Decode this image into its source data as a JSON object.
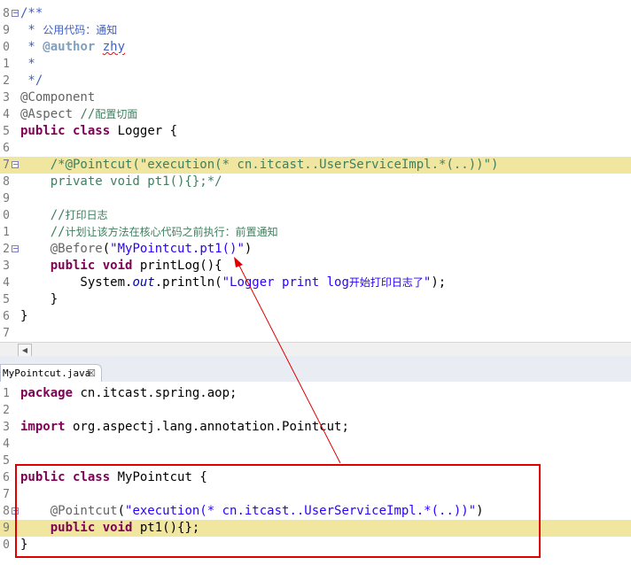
{
  "top_editor": {
    "lines": [
      {
        "num": "8",
        "fold": "−",
        "parts": [
          {
            "c": "jd",
            "t": "/**"
          }
        ]
      },
      {
        "num": "9",
        "parts": [
          {
            "c": "jd",
            "t": " * "
          },
          {
            "c": "jd cn",
            "t": "公用代码：通知"
          }
        ]
      },
      {
        "num": "0",
        "parts": [
          {
            "c": "jd",
            "t": " * "
          },
          {
            "c": "jdtag",
            "t": "@author"
          },
          {
            "c": "jd",
            "t": " "
          },
          {
            "c": "jd squig",
            "t": "zhy"
          }
        ]
      },
      {
        "num": "1",
        "parts": [
          {
            "c": "jd",
            "t": " *"
          }
        ]
      },
      {
        "num": "2",
        "parts": [
          {
            "c": "jd",
            "t": " */"
          }
        ]
      },
      {
        "num": "3",
        "parts": [
          {
            "c": "ann",
            "t": "@Component"
          }
        ]
      },
      {
        "num": "4",
        "parts": [
          {
            "c": "ann",
            "t": "@Aspect"
          },
          {
            "c": "",
            "t": " "
          },
          {
            "c": "cm",
            "t": "//"
          },
          {
            "c": "cm cn",
            "t": "配置切面"
          }
        ]
      },
      {
        "num": "5",
        "parts": [
          {
            "c": "kw",
            "t": "public"
          },
          {
            "c": "",
            "t": " "
          },
          {
            "c": "kw",
            "t": "class"
          },
          {
            "c": "",
            "t": " Logger {"
          }
        ]
      },
      {
        "num": "6",
        "parts": []
      },
      {
        "num": "7",
        "fold": "−",
        "hl": "hl2",
        "parts": [
          {
            "c": "",
            "t": "    "
          },
          {
            "c": "cm",
            "t": "/*@Pointcut(\"execution(* cn.itcast..UserServiceImpl.*(..))\")"
          }
        ]
      },
      {
        "num": "8",
        "parts": [
          {
            "c": "cm",
            "t": "    private void pt1(){};*/"
          }
        ]
      },
      {
        "num": "9",
        "parts": []
      },
      {
        "num": "0",
        "parts": [
          {
            "c": "cm",
            "t": "    //"
          },
          {
            "c": "cm cn",
            "t": "打印日志"
          }
        ]
      },
      {
        "num": "1",
        "parts": [
          {
            "c": "cm",
            "t": "    //"
          },
          {
            "c": "cm cn",
            "t": "计划让该方法在核心代码之前执行：前置通知"
          }
        ]
      },
      {
        "num": "2",
        "fold": "−",
        "parts": [
          {
            "c": "",
            "t": "    "
          },
          {
            "c": "ann",
            "t": "@Before"
          },
          {
            "c": "",
            "t": "("
          },
          {
            "c": "str",
            "t": "\"MyPointcut.pt1()\""
          },
          {
            "c": "",
            "t": ")"
          }
        ]
      },
      {
        "num": "3",
        "parts": [
          {
            "c": "",
            "t": "    "
          },
          {
            "c": "kw",
            "t": "public"
          },
          {
            "c": "",
            "t": " "
          },
          {
            "c": "kw",
            "t": "void"
          },
          {
            "c": "",
            "t": " printLog(){"
          }
        ]
      },
      {
        "num": "4",
        "parts": [
          {
            "c": "",
            "t": "        System."
          },
          {
            "c": "fld",
            "t": "out"
          },
          {
            "c": "",
            "t": ".println("
          },
          {
            "c": "str",
            "t": "\"Logger print log"
          },
          {
            "c": "str cn",
            "t": "开始打印日志了"
          },
          {
            "c": "str",
            "t": "\""
          },
          {
            "c": "",
            "t": ");"
          }
        ]
      },
      {
        "num": "5",
        "parts": [
          {
            "c": "",
            "t": "    }"
          }
        ]
      },
      {
        "num": "6",
        "parts": [
          {
            "c": "",
            "t": "}"
          }
        ]
      },
      {
        "num": "7",
        "parts": []
      }
    ]
  },
  "scroll_left_glyph": "◀",
  "tab": {
    "label": "MyPointcut.java",
    "close": "☒"
  },
  "bottom_editor": {
    "lines": [
      {
        "num": "1",
        "parts": [
          {
            "c": "kw",
            "t": "package"
          },
          {
            "c": "",
            "t": " cn.itcast.spring.aop;"
          }
        ]
      },
      {
        "num": "2",
        "parts": []
      },
      {
        "num": "3",
        "parts": [
          {
            "c": "kw",
            "t": "import"
          },
          {
            "c": "",
            "t": " org.aspectj.lang.annotation.Pointcut;"
          }
        ]
      },
      {
        "num": "4",
        "parts": []
      },
      {
        "num": "5",
        "parts": []
      },
      {
        "num": "6",
        "parts": [
          {
            "c": "kw",
            "t": "public"
          },
          {
            "c": "",
            "t": " "
          },
          {
            "c": "kw",
            "t": "class"
          },
          {
            "c": "",
            "t": " MyPointcut {"
          }
        ]
      },
      {
        "num": "7",
        "parts": []
      },
      {
        "num": "8",
        "fold": "−",
        "parts": [
          {
            "c": "",
            "t": "    "
          },
          {
            "c": "ann",
            "t": "@Pointcut"
          },
          {
            "c": "",
            "t": "("
          },
          {
            "c": "str",
            "t": "\"execution(* cn.itcast..UserServiceImpl.*(..))\""
          },
          {
            "c": "",
            "t": ")"
          }
        ]
      },
      {
        "num": "9",
        "hl": "hl2",
        "parts": [
          {
            "c": "",
            "t": "    "
          },
          {
            "c": "kw",
            "t": "public"
          },
          {
            "c": "",
            "t": " "
          },
          {
            "c": "kw",
            "t": "void"
          },
          {
            "c": "",
            "t": " pt1(){};"
          }
        ]
      },
      {
        "num": "0",
        "parts": [
          {
            "c": "",
            "t": "}"
          }
        ]
      }
    ]
  },
  "colors": {
    "annotation_box": "#e00000",
    "arrow": "#e00000",
    "current_line": "#f0e6a0"
  }
}
